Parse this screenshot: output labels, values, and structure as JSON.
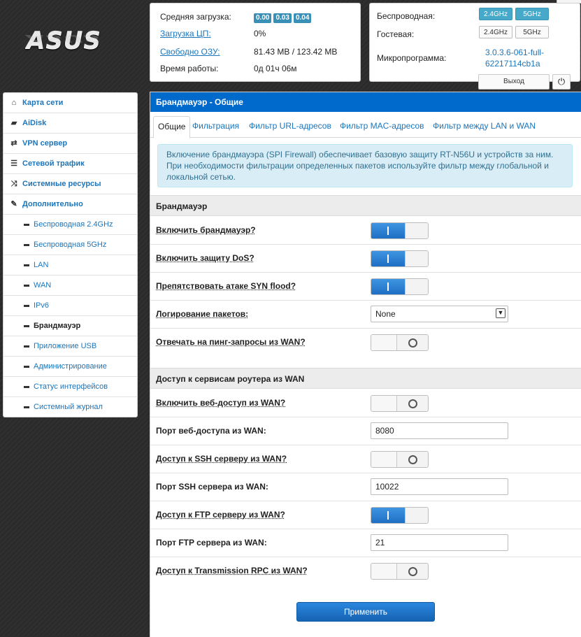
{
  "brand": {
    "logo_text": "ASUS"
  },
  "status": {
    "avg_load_label": "Средняя загрузка:",
    "load_values": [
      "0.00",
      "0.03",
      "0.04"
    ],
    "cpu_label": "Загрузка ЦП:",
    "cpu_value": "0%",
    "ram_label": "Свободно ОЗУ:",
    "ram_value": "81.43 MB / 123.42 MB",
    "uptime_label": "Время работы:",
    "uptime_value": "0д 01ч 06м"
  },
  "wireless": {
    "wireless_label": "Беспроводная:",
    "guest_label": "Гостевая:",
    "firmware_label": "Микропрограмма:",
    "band_24": "2.4GHz",
    "band_5": "5GHz",
    "firmware_value": "3.0.3.6-061-full-62217114cb1a",
    "logout_label": "Выход",
    "power_icon": "⏻"
  },
  "menu": {
    "items": [
      {
        "label": "Карта сети",
        "icon": "home-icon",
        "glyph": "⌂"
      },
      {
        "label": "AiDisk",
        "icon": "disk-icon",
        "glyph": "▰"
      },
      {
        "label": "VPN сервер",
        "icon": "vpn-icon",
        "glyph": "⇄"
      },
      {
        "label": "Сетевой трафик",
        "icon": "traffic-icon",
        "glyph": "☰"
      },
      {
        "label": "Системные ресурсы",
        "icon": "shuffle-icon",
        "glyph": "⤨"
      },
      {
        "label": "Дополнительно",
        "icon": "wrench-icon",
        "glyph": "✎"
      }
    ],
    "sub_items": [
      {
        "label": "Беспроводная 2.4GHz"
      },
      {
        "label": "Беспроводная 5GHz"
      },
      {
        "label": "LAN"
      },
      {
        "label": "WAN"
      },
      {
        "label": "IPv6"
      },
      {
        "label": "Брандмауэр"
      },
      {
        "label": "Приложение USB"
      },
      {
        "label": "Администрирование"
      },
      {
        "label": "Статус интерфейсов"
      },
      {
        "label": "Системный журнал"
      }
    ]
  },
  "main": {
    "title": "Брандмауэр - Общие",
    "tabs": [
      "Общие",
      "Фильтрация",
      "Фильтр URL-адресов",
      "Фильтр MAC-адресов",
      "Фильтр между LAN и WAN"
    ],
    "info": "Включение брандмауэра (SPI Firewall) обеспечивает базовую защиту RT-N56U и устройств за ним. При необходимости фильтрации определенных пакетов используйте фильтр между глобальной и локальной сетью.",
    "section_firewall": "Брандмауэр",
    "enable_firewall": "Включить брандмауэр?",
    "enable_dos": "Включить защиту DoS?",
    "syn_flood": "Препятствовать атаке SYN flood?",
    "packet_logging": "Логирование пакетов:",
    "packet_logging_value": "None",
    "ping_wan": "Отвечать на пинг-запросы из WAN?",
    "section_services": "Доступ к сервисам роутера из WAN",
    "web_access": "Включить веб-доступ из WAN?",
    "web_port": "Порт веб-доступа из WAN:",
    "web_port_value": "8080",
    "ssh_access": "Доступ к SSH серверу из WAN?",
    "ssh_port": "Порт SSH сервера из WAN:",
    "ssh_port_value": "10022",
    "ftp_access": "Доступ к FTP серверу из WAN?",
    "ftp_port": "Порт FTP сервера из WAN:",
    "ftp_port_value": "21",
    "transmission_access": "Доступ к Transmission RPC из WAN?",
    "apply_label": "Применить",
    "toggle_states": {
      "enable_firewall": true,
      "enable_dos": true,
      "syn_flood": true,
      "ping_wan": false,
      "web_access": false,
      "ssh_access": false,
      "ftp_access": true,
      "transmission_access": false
    }
  }
}
